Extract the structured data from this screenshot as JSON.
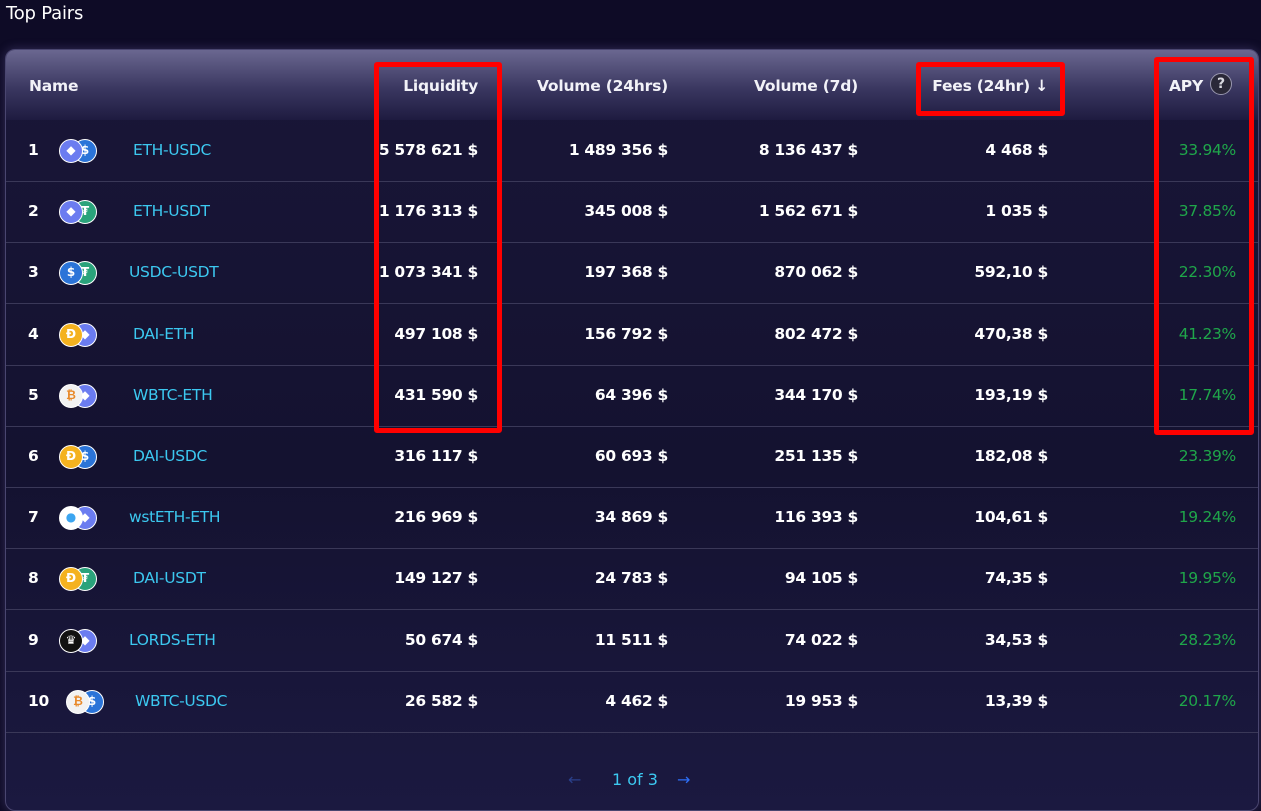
{
  "page": {
    "title": "Top Pairs"
  },
  "columns": {
    "name": "Name",
    "liquidity": "Liquidity",
    "volume24": "Volume (24hrs)",
    "volume7d": "Volume (7d)",
    "fees24": "Fees (24hr) ↓",
    "apy": "APY",
    "help_icon": "?"
  },
  "rows": [
    {
      "rank": "1",
      "pair": "ETH-USDC",
      "liquidity": "5 578 621 $",
      "volume24": "1 489 356 $",
      "volume7d": "8 136 437 $",
      "fees": "4 468 $",
      "apy": "33.94%",
      "icons": [
        "eth-icon",
        "usdc-icon"
      ]
    },
    {
      "rank": "2",
      "pair": "ETH-USDT",
      "liquidity": "1 176 313 $",
      "volume24": "345 008 $",
      "volume7d": "1 562 671 $",
      "fees": "1 035 $",
      "apy": "37.85%",
      "icons": [
        "eth-icon",
        "usdt-icon"
      ]
    },
    {
      "rank": "3",
      "pair": "USDC-USDT",
      "liquidity": "1 073 341 $",
      "volume24": "197 368 $",
      "volume7d": "870 062 $",
      "fees": "592,10 $",
      "apy": "22.30%",
      "icons": [
        "usdc-icon",
        "usdt-icon"
      ]
    },
    {
      "rank": "4",
      "pair": "DAI-ETH",
      "liquidity": "497 108 $",
      "volume24": "156 792 $",
      "volume7d": "802 472 $",
      "fees": "470,38 $",
      "apy": "41.23%",
      "icons": [
        "dai-icon",
        "eth-icon"
      ]
    },
    {
      "rank": "5",
      "pair": "WBTC-ETH",
      "liquidity": "431 590 $",
      "volume24": "64 396 $",
      "volume7d": "344 170 $",
      "fees": "193,19 $",
      "apy": "17.74%",
      "icons": [
        "wbtc-icon",
        "eth-icon"
      ]
    },
    {
      "rank": "6",
      "pair": "DAI-USDC",
      "liquidity": "316 117 $",
      "volume24": "60 693 $",
      "volume7d": "251 135 $",
      "fees": "182,08 $",
      "apy": "23.39%",
      "icons": [
        "dai-icon",
        "usdc-icon"
      ]
    },
    {
      "rank": "7",
      "pair": "wstETH-ETH",
      "liquidity": "216 969 $",
      "volume24": "34 869 $",
      "volume7d": "116 393 $",
      "fees": "104,61 $",
      "apy": "19.24%",
      "icons": [
        "wsteth-icon",
        "eth-icon"
      ]
    },
    {
      "rank": "8",
      "pair": "DAI-USDT",
      "liquidity": "149 127 $",
      "volume24": "24 783 $",
      "volume7d": "94 105 $",
      "fees": "74,35 $",
      "apy": "19.95%",
      "icons": [
        "dai-icon",
        "usdt-icon"
      ]
    },
    {
      "rank": "9",
      "pair": "LORDS-ETH",
      "liquidity": "50 674 $",
      "volume24": "11 511 $",
      "volume7d": "74 022 $",
      "fees": "34,53 $",
      "apy": "28.23%",
      "icons": [
        "lords-icon",
        "eth-icon"
      ]
    },
    {
      "rank": "10",
      "pair": "WBTC-USDC",
      "liquidity": "26 582 $",
      "volume24": "4 462 $",
      "volume7d": "19 953 $",
      "fees": "13,39 $",
      "apy": "20.17%",
      "icons": [
        "wbtc-icon",
        "usdc-icon"
      ]
    }
  ],
  "pagination": {
    "prev": "←",
    "label": "1 of 3",
    "next": "→"
  },
  "colors": {
    "background": "#0e0b26",
    "pair_link": "#3cc8f0",
    "apy_green": "#1fa64a",
    "highlight": "#ff0000"
  }
}
